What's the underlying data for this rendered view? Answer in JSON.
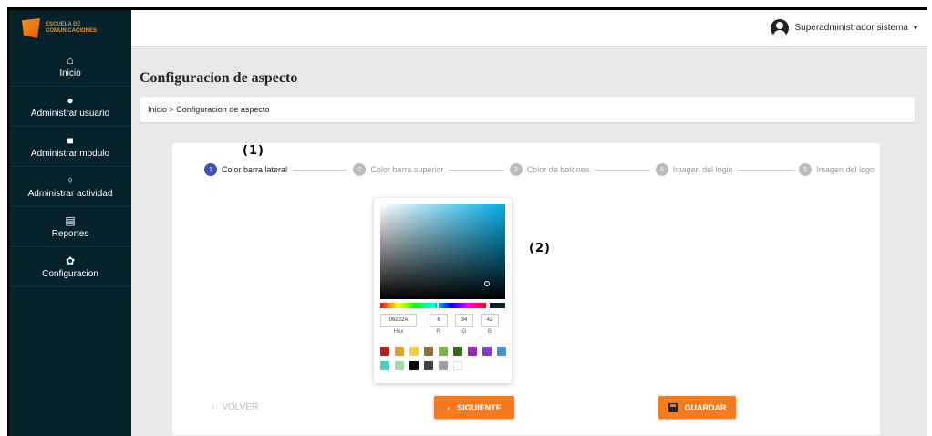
{
  "brand": {
    "logo_line1": "ESCUELA DE",
    "logo_line2": "COMUNICACIONES"
  },
  "sidebar": {
    "items": [
      {
        "label": "Inicio",
        "icon": "home-icon"
      },
      {
        "label": "Administrar usuario",
        "icon": "user-icon"
      },
      {
        "label": "Administrar modulo",
        "icon": "module-icon"
      },
      {
        "label": "Administrar actividad",
        "icon": "bulb-icon"
      },
      {
        "label": "Reportes",
        "icon": "document-icon"
      },
      {
        "label": "Configuracion",
        "icon": "palette-icon"
      }
    ]
  },
  "topbar": {
    "user_name": "Superadministrador sistema",
    "caret": "▾"
  },
  "page": {
    "title": "Configuracion de aspecto",
    "breadcrumb": "Inicio > Configuracion de aspecto"
  },
  "annotations": {
    "step_marker": "(1)",
    "picker_marker": "(2)"
  },
  "stepper": {
    "active_index": 0,
    "steps": [
      {
        "num": "1",
        "label": "Color barra lateral"
      },
      {
        "num": "2",
        "label": "Color barra superior"
      },
      {
        "num": "3",
        "label": "Color de botones"
      },
      {
        "num": "4",
        "label": "Imagen del login"
      },
      {
        "num": "5",
        "label": "Imagen del logo"
      }
    ]
  },
  "color_picker": {
    "hex": "06222A",
    "r": "6",
    "g": "34",
    "b": "42",
    "labels": {
      "hex": "Hex",
      "r": "R",
      "g": "G",
      "b": "B"
    },
    "selected_color": "#06222a",
    "swatches": [
      "#b71c1c",
      "#e0a030",
      "#f0d040",
      "#8d6e40",
      "#7cb342",
      "#33691e",
      "#9c27b0",
      "#7b3fd0",
      "#4a90d0",
      "#4dd0c0",
      "#a5d6a7",
      "#000000",
      "#424242",
      "#9e9e9e",
      "#ffffff"
    ]
  },
  "actions": {
    "back_label": "VOLVER",
    "back_icon": "‹",
    "next_label": "SIGUIENTE",
    "next_icon": "›",
    "save_label": "GUARDAR"
  },
  "colors": {
    "sidebar_bg": "#06222a",
    "accent_orange": "#f47a20",
    "step_active": "#3f51b5"
  }
}
